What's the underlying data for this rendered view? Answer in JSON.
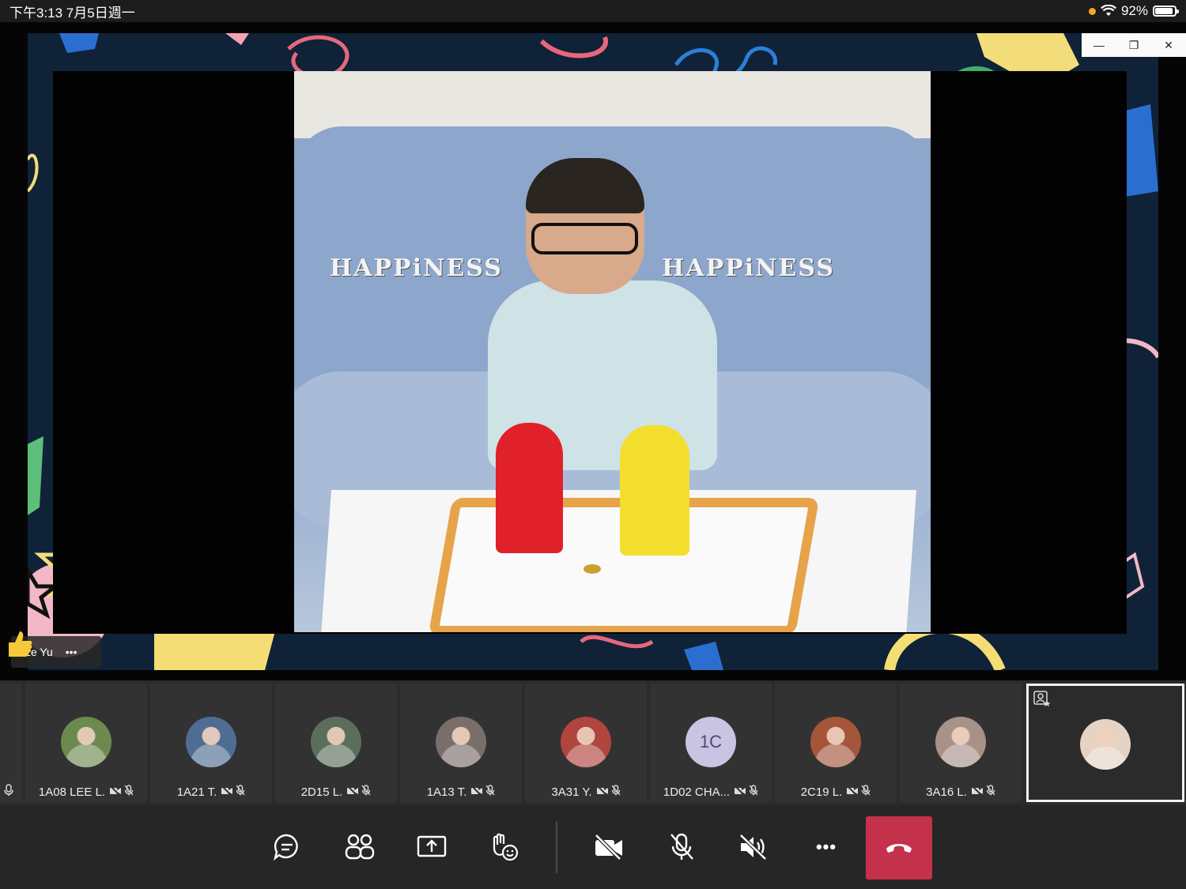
{
  "status_bar": {
    "time_date": "下午3:13   7月5日週一",
    "battery": "92%",
    "battery_level": 0.92
  },
  "stage": {
    "presenter_name": "ze Yu",
    "more_label": "•••",
    "window_controls": [
      "—",
      "❐",
      "✕"
    ],
    "video_text_left": "HAPPiNESS",
    "video_text_right": "HAPPiNESS"
  },
  "participants": [
    {
      "label": "1A08 LEE L.",
      "avatar": "photo",
      "color": "#6d8a4e"
    },
    {
      "label": "1A21 T.",
      "avatar": "photo",
      "color": "#4f6d92"
    },
    {
      "label": "2D15 L.",
      "avatar": "photo",
      "color": "#5a6e5a"
    },
    {
      "label": "1A13 T.",
      "avatar": "photo",
      "color": "#7a6e6a"
    },
    {
      "label": "3A31 Y.",
      "avatar": "photo",
      "color": "#b0443e"
    },
    {
      "label": "1D02 CHA...",
      "avatar": "initials",
      "initials": "1C",
      "color": "#c9c4e2"
    },
    {
      "label": "2C19 L.",
      "avatar": "photo",
      "color": "#a4553a"
    },
    {
      "label": "3A16 L.",
      "avatar": "photo",
      "color": "#a89288"
    },
    {
      "label": "",
      "avatar": "photo",
      "color": "#e6d3c4"
    }
  ],
  "toolbar": {
    "buttons": [
      "chat-icon",
      "participants-icon",
      "share-icon",
      "reactions-icon",
      "camera-off-icon",
      "mic-off-icon",
      "speaker-off-icon",
      "more-icon"
    ],
    "more_label": "•••",
    "hangup_color": "#c4314b"
  }
}
